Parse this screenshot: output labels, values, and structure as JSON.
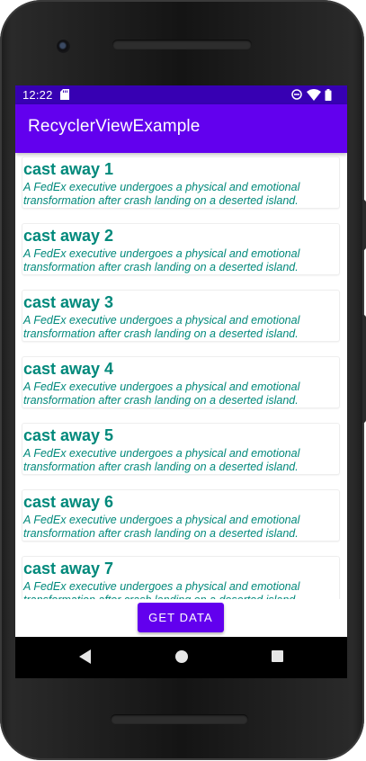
{
  "status_bar": {
    "time": "12:22",
    "icons": [
      "sd-card-icon",
      "do-not-disturb-icon",
      "wifi-icon",
      "battery-icon"
    ]
  },
  "app_bar": {
    "title": "RecyclerViewExample"
  },
  "list": {
    "items": [
      {
        "title": "cast away 1",
        "description": "A FedEx executive undergoes a physical and emotional transformation after crash landing on a deserted island."
      },
      {
        "title": "cast away 2",
        "description": "A FedEx executive undergoes a physical and emotional transformation after crash landing on a deserted island."
      },
      {
        "title": "cast away 3",
        "description": "A FedEx executive undergoes a physical and emotional transformation after crash landing on a deserted island."
      },
      {
        "title": "cast away 4",
        "description": "A FedEx executive undergoes a physical and emotional transformation after crash landing on a deserted island."
      },
      {
        "title": "cast away 5",
        "description": "A FedEx executive undergoes a physical and emotional transformation after crash landing on a deserted island."
      },
      {
        "title": "cast away 6",
        "description": "A FedEx executive undergoes a physical and emotional transformation after crash landing on a deserted island."
      },
      {
        "title": "cast away 7",
        "description": "A FedEx executive undergoes a physical and emotional transformation after crash landing on a deserted island."
      }
    ]
  },
  "get_data_button": {
    "label": "GET DATA"
  },
  "nav_bar": {
    "icons": [
      "back-icon",
      "home-icon",
      "recents-icon"
    ]
  },
  "colors": {
    "primary": "#6200ee",
    "primary_dark": "#3700b3",
    "item_text": "#00897b"
  }
}
